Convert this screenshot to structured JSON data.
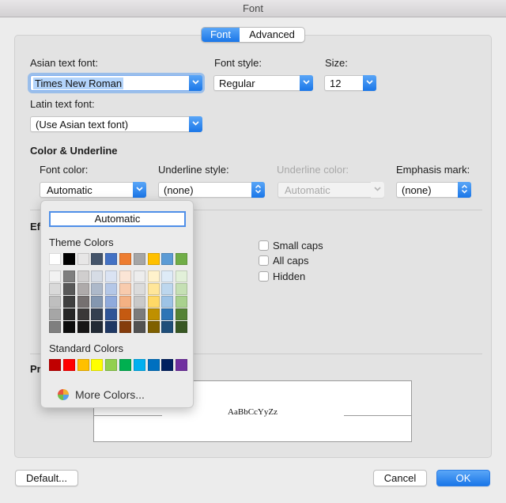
{
  "window": {
    "title": "Font"
  },
  "tabs": [
    {
      "label": "Font"
    },
    {
      "label": "Advanced"
    }
  ],
  "font_section": {
    "asian_label": "Asian text font:",
    "asian_value": "Times New Roman",
    "style_label": "Font style:",
    "style_value": "Regular",
    "size_label": "Size:",
    "size_value": "12",
    "latin_label": "Latin text font:",
    "latin_value": "(Use Asian text font)"
  },
  "color_underline": {
    "heading": "Color & Underline",
    "font_color_label": "Font color:",
    "font_color_value": "Automatic",
    "underline_style_label": "Underline style:",
    "underline_style_value": "(none)",
    "underline_color_label": "Underline color:",
    "underline_color_value": "Automatic",
    "emphasis_label": "Emphasis mark:",
    "emphasis_value": "(none)"
  },
  "effects": {
    "heading_partial": "Ef",
    "small_caps": "Small caps",
    "all_caps": "All caps",
    "hidden": "Hidden"
  },
  "preview": {
    "heading_partial": "Pr",
    "sample": "AaBbCcYyZz"
  },
  "buttons": {
    "default": "Default...",
    "cancel": "Cancel",
    "ok": "OK"
  },
  "color_picker": {
    "automatic": "Automatic",
    "theme_label": "Theme Colors",
    "standard_label": "Standard Colors",
    "more_colors": "More Colors...",
    "theme_columns": [
      [
        "#ffffff",
        "#f2f2f2",
        "#d9d9d9",
        "#bfbfbf",
        "#a6a6a6",
        "#7f7f7f"
      ],
      [
        "#000000",
        "#7f7f7f",
        "#595959",
        "#3f3f3f",
        "#262626",
        "#0d0d0d"
      ],
      [
        "#e7e6e6",
        "#d0cece",
        "#aeaaaa",
        "#757070",
        "#3a3838",
        "#171616"
      ],
      [
        "#44546a",
        "#d6dce5",
        "#adb9ca",
        "#8497b0",
        "#333f50",
        "#222a35"
      ],
      [
        "#4472c4",
        "#dae3f3",
        "#b4c7e7",
        "#8faadc",
        "#2f5597",
        "#1f3864"
      ],
      [
        "#ed7d31",
        "#fbe5d6",
        "#f8cbad",
        "#f4b183",
        "#c55a11",
        "#843c0c"
      ],
      [
        "#a5a5a5",
        "#ededed",
        "#dbdbdb",
        "#c9c9c9",
        "#7b7b7b",
        "#525252"
      ],
      [
        "#ffc000",
        "#fff2cc",
        "#ffe699",
        "#ffd966",
        "#bf9000",
        "#7f6000"
      ],
      [
        "#5b9bd5",
        "#deebf7",
        "#bdd7ee",
        "#9dc3e6",
        "#2e75b6",
        "#1f4e79"
      ],
      [
        "#70ad47",
        "#e2f0d9",
        "#c5e0b4",
        "#a9d18e",
        "#548235",
        "#385723"
      ]
    ],
    "standard_colors": [
      "#c00000",
      "#ff0000",
      "#ffc000",
      "#ffff00",
      "#92d050",
      "#00b050",
      "#00b0f0",
      "#0070c0",
      "#002060",
      "#7030a0"
    ]
  }
}
